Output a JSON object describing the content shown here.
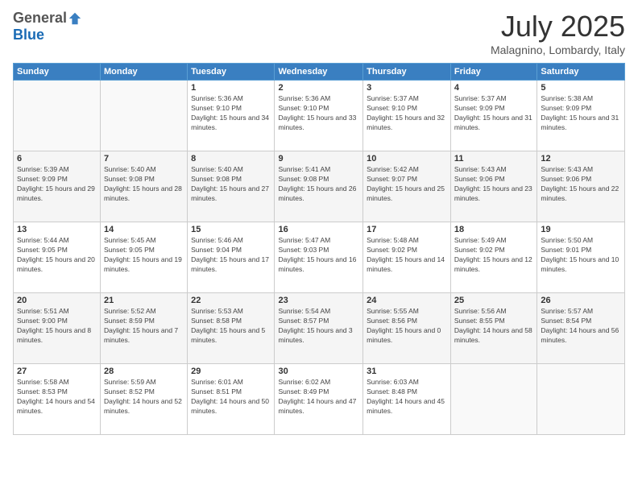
{
  "logo": {
    "general": "General",
    "blue": "Blue"
  },
  "header": {
    "month": "July 2025",
    "location": "Malagnino, Lombardy, Italy"
  },
  "weekdays": [
    "Sunday",
    "Monday",
    "Tuesday",
    "Wednesday",
    "Thursday",
    "Friday",
    "Saturday"
  ],
  "weeks": [
    [
      {
        "day": "",
        "info": ""
      },
      {
        "day": "",
        "info": ""
      },
      {
        "day": "1",
        "info": "Sunrise: 5:36 AM\nSunset: 9:10 PM\nDaylight: 15 hours and 34 minutes."
      },
      {
        "day": "2",
        "info": "Sunrise: 5:36 AM\nSunset: 9:10 PM\nDaylight: 15 hours and 33 minutes."
      },
      {
        "day": "3",
        "info": "Sunrise: 5:37 AM\nSunset: 9:10 PM\nDaylight: 15 hours and 32 minutes."
      },
      {
        "day": "4",
        "info": "Sunrise: 5:37 AM\nSunset: 9:09 PM\nDaylight: 15 hours and 31 minutes."
      },
      {
        "day": "5",
        "info": "Sunrise: 5:38 AM\nSunset: 9:09 PM\nDaylight: 15 hours and 31 minutes."
      }
    ],
    [
      {
        "day": "6",
        "info": "Sunrise: 5:39 AM\nSunset: 9:09 PM\nDaylight: 15 hours and 29 minutes."
      },
      {
        "day": "7",
        "info": "Sunrise: 5:40 AM\nSunset: 9:08 PM\nDaylight: 15 hours and 28 minutes."
      },
      {
        "day": "8",
        "info": "Sunrise: 5:40 AM\nSunset: 9:08 PM\nDaylight: 15 hours and 27 minutes."
      },
      {
        "day": "9",
        "info": "Sunrise: 5:41 AM\nSunset: 9:08 PM\nDaylight: 15 hours and 26 minutes."
      },
      {
        "day": "10",
        "info": "Sunrise: 5:42 AM\nSunset: 9:07 PM\nDaylight: 15 hours and 25 minutes."
      },
      {
        "day": "11",
        "info": "Sunrise: 5:43 AM\nSunset: 9:06 PM\nDaylight: 15 hours and 23 minutes."
      },
      {
        "day": "12",
        "info": "Sunrise: 5:43 AM\nSunset: 9:06 PM\nDaylight: 15 hours and 22 minutes."
      }
    ],
    [
      {
        "day": "13",
        "info": "Sunrise: 5:44 AM\nSunset: 9:05 PM\nDaylight: 15 hours and 20 minutes."
      },
      {
        "day": "14",
        "info": "Sunrise: 5:45 AM\nSunset: 9:05 PM\nDaylight: 15 hours and 19 minutes."
      },
      {
        "day": "15",
        "info": "Sunrise: 5:46 AM\nSunset: 9:04 PM\nDaylight: 15 hours and 17 minutes."
      },
      {
        "day": "16",
        "info": "Sunrise: 5:47 AM\nSunset: 9:03 PM\nDaylight: 15 hours and 16 minutes."
      },
      {
        "day": "17",
        "info": "Sunrise: 5:48 AM\nSunset: 9:02 PM\nDaylight: 15 hours and 14 minutes."
      },
      {
        "day": "18",
        "info": "Sunrise: 5:49 AM\nSunset: 9:02 PM\nDaylight: 15 hours and 12 minutes."
      },
      {
        "day": "19",
        "info": "Sunrise: 5:50 AM\nSunset: 9:01 PM\nDaylight: 15 hours and 10 minutes."
      }
    ],
    [
      {
        "day": "20",
        "info": "Sunrise: 5:51 AM\nSunset: 9:00 PM\nDaylight: 15 hours and 8 minutes."
      },
      {
        "day": "21",
        "info": "Sunrise: 5:52 AM\nSunset: 8:59 PM\nDaylight: 15 hours and 7 minutes."
      },
      {
        "day": "22",
        "info": "Sunrise: 5:53 AM\nSunset: 8:58 PM\nDaylight: 15 hours and 5 minutes."
      },
      {
        "day": "23",
        "info": "Sunrise: 5:54 AM\nSunset: 8:57 PM\nDaylight: 15 hours and 3 minutes."
      },
      {
        "day": "24",
        "info": "Sunrise: 5:55 AM\nSunset: 8:56 PM\nDaylight: 15 hours and 0 minutes."
      },
      {
        "day": "25",
        "info": "Sunrise: 5:56 AM\nSunset: 8:55 PM\nDaylight: 14 hours and 58 minutes."
      },
      {
        "day": "26",
        "info": "Sunrise: 5:57 AM\nSunset: 8:54 PM\nDaylight: 14 hours and 56 minutes."
      }
    ],
    [
      {
        "day": "27",
        "info": "Sunrise: 5:58 AM\nSunset: 8:53 PM\nDaylight: 14 hours and 54 minutes."
      },
      {
        "day": "28",
        "info": "Sunrise: 5:59 AM\nSunset: 8:52 PM\nDaylight: 14 hours and 52 minutes."
      },
      {
        "day": "29",
        "info": "Sunrise: 6:01 AM\nSunset: 8:51 PM\nDaylight: 14 hours and 50 minutes."
      },
      {
        "day": "30",
        "info": "Sunrise: 6:02 AM\nSunset: 8:49 PM\nDaylight: 14 hours and 47 minutes."
      },
      {
        "day": "31",
        "info": "Sunrise: 6:03 AM\nSunset: 8:48 PM\nDaylight: 14 hours and 45 minutes."
      },
      {
        "day": "",
        "info": ""
      },
      {
        "day": "",
        "info": ""
      }
    ]
  ]
}
